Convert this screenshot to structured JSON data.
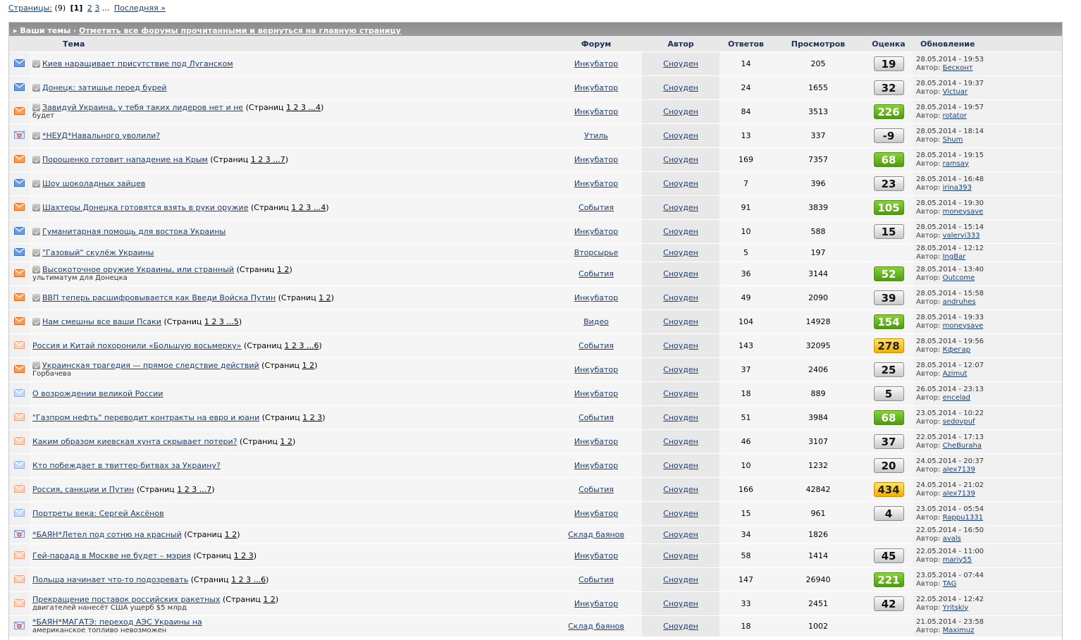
{
  "pager": {
    "label": "Страницы:",
    "count": "(9)",
    "current": "[1]",
    "pages": [
      "2",
      "3"
    ],
    "ellipsis": "...",
    "last": "Последняя »"
  },
  "bar": {
    "title": "Ваши темы",
    "sep": " · ",
    "link": "Отметить все форумы прочитанными и вернуться на главную страницу"
  },
  "headers": {
    "topic": "Тема",
    "forum": "Форум",
    "author": "Автор",
    "replies": "Ответов",
    "views": "Просмотров",
    "rating": "Оценка",
    "updated": "Обновление"
  },
  "strings": {
    "pages_prefix": "(Страниц ",
    "pages_suffix": ")",
    "author_prefix": "Автор:"
  },
  "colors": {
    "blue_env": "#4a7fc8",
    "orange_env": "#f07a22",
    "light_env": "#f3b89a",
    "green": "#67b21f",
    "yellow": "#f5c518"
  },
  "rows": [
    {
      "icon": "envelope-blue",
      "poll": true,
      "title": "Киев наращивает присутствие под Луганском",
      "pages": "",
      "sub": "",
      "forum": "Инкубатор",
      "author": "Сноуден",
      "replies": "14",
      "views": "205",
      "rating": "19",
      "rating_color": "gray",
      "date": "28.05.2014 - 19:53",
      "last_author": "Бесконт"
    },
    {
      "icon": "envelope-blue",
      "poll": true,
      "title": "Донецк: затишье перед бурей",
      "pages": "",
      "sub": "",
      "forum": "Инкубатор",
      "author": "Сноуден",
      "replies": "24",
      "views": "1655",
      "rating": "32",
      "rating_color": "gray",
      "date": "28.05.2014 - 19:37",
      "last_author": "Victuar"
    },
    {
      "icon": "envelope-orange",
      "poll": true,
      "title": "Завидуй Украина, у тебя таких лидеров нет и не",
      "pages": "1 2 3 ...4",
      "sub": "будет",
      "forum": "Инкубатор",
      "author": "Сноуден",
      "replies": "84",
      "views": "3513",
      "rating": "226",
      "rating_color": "green",
      "date": "28.05.2014 - 19:57",
      "last_author": "rotator"
    },
    {
      "icon": "locked",
      "poll": true,
      "title": "*НЕУД*Навального уволили?",
      "pages": "",
      "sub": "",
      "forum": "Утиль",
      "author": "Сноуден",
      "replies": "13",
      "views": "337",
      "rating": "-9",
      "rating_color": "gray",
      "date": "28.05.2014 - 18:14",
      "last_author": "Shum"
    },
    {
      "icon": "envelope-orange",
      "poll": true,
      "title": "Порошенко готовит нападение на Крым",
      "pages": "1 2 3 ...7",
      "sub": "",
      "forum": "Инкубатор",
      "author": "Сноуден",
      "replies": "169",
      "views": "7357",
      "rating": "68",
      "rating_color": "green",
      "date": "28.05.2014 - 19:15",
      "last_author": "ramsay"
    },
    {
      "icon": "envelope-blue",
      "poll": true,
      "title": "Шоу шоколадных зайцев",
      "pages": "",
      "sub": "",
      "forum": "Инкубатор",
      "author": "Сноуден",
      "replies": "7",
      "views": "396",
      "rating": "23",
      "rating_color": "gray",
      "date": "28.05.2014 - 16:48",
      "last_author": "irina393"
    },
    {
      "icon": "envelope-orange",
      "poll": true,
      "title": "Шахтеры Донецка готовятся взять в руки оружие",
      "pages": "1 2 3 ...4",
      "sub": "",
      "forum": "События",
      "author": "Сноуден",
      "replies": "91",
      "views": "3839",
      "rating": "105",
      "rating_color": "green",
      "date": "28.05.2014 - 19:30",
      "last_author": "moneysave"
    },
    {
      "icon": "envelope-blue",
      "poll": true,
      "title": "Гуманитарная помощь для востока Украины",
      "pages": "",
      "sub": "",
      "forum": "Инкубатор",
      "author": "Сноуден",
      "replies": "10",
      "views": "588",
      "rating": "15",
      "rating_color": "gray",
      "date": "28.05.2014 - 15:14",
      "last_author": "valeryi333"
    },
    {
      "icon": "envelope-blue",
      "poll": true,
      "title": "\"Газовый\" скулёж Украины",
      "pages": "",
      "sub": "",
      "forum": "Вторсырье",
      "author": "Сноуден",
      "replies": "5",
      "views": "197",
      "rating": "",
      "rating_color": "none",
      "date": "28.05.2014 - 12:12",
      "last_author": "IngBar"
    },
    {
      "icon": "envelope-orange",
      "poll": true,
      "title": "Высокоточное оружие Украины, или странный",
      "pages": "1 2",
      "sub": "ультиматум для Донецка",
      "forum": "События",
      "author": "Сноуден",
      "replies": "36",
      "views": "3144",
      "rating": "52",
      "rating_color": "green",
      "date": "28.05.2014 - 13:40",
      "last_author": "Outcome"
    },
    {
      "icon": "envelope-orange",
      "poll": true,
      "title": "ВВП теперь расшифровывается как Введи Войска Путин",
      "pages": "1 2",
      "sub": "",
      "forum": "Инкубатор",
      "author": "Сноуден",
      "replies": "49",
      "views": "2090",
      "rating": "39",
      "rating_color": "gray",
      "date": "28.05.2014 - 15:58",
      "last_author": "andruhes"
    },
    {
      "icon": "envelope-orange",
      "poll": true,
      "title": "Нам смешны все ваши Псаки",
      "pages": "1 2 3 ...5",
      "sub": "",
      "forum": "Видео",
      "author": "Сноуден",
      "replies": "104",
      "views": "14928",
      "rating": "154",
      "rating_color": "green",
      "date": "28.05.2014 - 19:33",
      "last_author": "moneysave"
    },
    {
      "icon": "envelope-light",
      "poll": false,
      "title": "Россия и Китай похоронили «Большую восьмерку»",
      "pages": "1 2 3 ...6",
      "sub": "",
      "forum": "События",
      "author": "Сноуден",
      "replies": "143",
      "views": "32095",
      "rating": "278",
      "rating_color": "yellow",
      "date": "28.05.2014 - 19:56",
      "last_author": "Кфегар"
    },
    {
      "icon": "envelope-orange",
      "poll": true,
      "title": "Украинская трагедия — прямое следствие действий",
      "pages": "1 2",
      "sub": "Горбачева",
      "forum": "Инкубатор",
      "author": "Сноуден",
      "replies": "37",
      "views": "2406",
      "rating": "25",
      "rating_color": "gray",
      "date": "28.05.2014 - 12:07",
      "last_author": "Azimut"
    },
    {
      "icon": "envelope-lightblue",
      "poll": false,
      "title": "О возрождении великой России",
      "pages": "",
      "sub": "",
      "forum": "Инкубатор",
      "author": "Сноуден",
      "replies": "18",
      "views": "889",
      "rating": "5",
      "rating_color": "gray",
      "date": "26.05.2014 - 23:13",
      "last_author": "encelad"
    },
    {
      "icon": "envelope-light",
      "poll": false,
      "title": "\"Газпром нефть\" переводит контракты на евро и юани",
      "pages": "1 2 3",
      "sub": "",
      "forum": "События",
      "author": "Сноуден",
      "replies": "51",
      "views": "3984",
      "rating": "68",
      "rating_color": "green",
      "date": "23.05.2014 - 10:22",
      "last_author": "sedovpuf"
    },
    {
      "icon": "envelope-light",
      "poll": false,
      "title": "Каким образом киевская хунта скрывает потери?",
      "pages": "1 2",
      "sub": "",
      "forum": "Инкубатор",
      "author": "Сноуден",
      "replies": "46",
      "views": "3107",
      "rating": "37",
      "rating_color": "gray",
      "date": "22.05.2014 - 17:13",
      "last_author": "CheBuraha"
    },
    {
      "icon": "envelope-lightblue",
      "poll": false,
      "title": "Кто побеждает в твиттер-битвах за Украину?",
      "pages": "",
      "sub": "",
      "forum": "Инкубатор",
      "author": "Сноуден",
      "replies": "10",
      "views": "1232",
      "rating": "20",
      "rating_color": "gray",
      "date": "24.05.2014 - 20:37",
      "last_author": "alex7139"
    },
    {
      "icon": "envelope-light",
      "poll": false,
      "title": "Россия, санкции и Путин",
      "pages": "1 2 3 ...7",
      "sub": "",
      "forum": "События",
      "author": "Сноуден",
      "replies": "166",
      "views": "42842",
      "rating": "434",
      "rating_color": "yellow",
      "date": "24.05.2014 - 21:02",
      "last_author": "alex7139"
    },
    {
      "icon": "envelope-lightblue",
      "poll": false,
      "title": "Портреты века: Сергей Аксёнов",
      "pages": "",
      "sub": "",
      "forum": "Инкубатор",
      "author": "Сноуден",
      "replies": "15",
      "views": "961",
      "rating": "4",
      "rating_color": "gray",
      "date": "23.05.2014 - 05:54",
      "last_author": "Rappu1331"
    },
    {
      "icon": "locked",
      "poll": false,
      "title": "*БАЯН*Летел под сотню на красный",
      "pages": "1 2",
      "sub": "",
      "forum": "Склад баянов",
      "author": "Сноуден",
      "replies": "34",
      "views": "1826",
      "rating": "",
      "rating_color": "none",
      "date": "22.05.2014 - 16:50",
      "last_author": "avals"
    },
    {
      "icon": "envelope-light",
      "poll": false,
      "title": "Гей-парада в Москве не будет – мэрия",
      "pages": "1 2 3",
      "sub": "",
      "forum": "Инкубатор",
      "author": "Сноуден",
      "replies": "58",
      "views": "1414",
      "rating": "45",
      "rating_color": "gray",
      "date": "22.05.2014 - 11:00",
      "last_author": "mariy55"
    },
    {
      "icon": "envelope-light",
      "poll": false,
      "title": "Польша начинает что-то подозревать",
      "pages": "1 2 3 ...6",
      "sub": "",
      "forum": "События",
      "author": "Сноуден",
      "replies": "147",
      "views": "26940",
      "rating": "221",
      "rating_color": "green",
      "date": "23.05.2014 - 07:44",
      "last_author": "TAG"
    },
    {
      "icon": "envelope-light",
      "poll": false,
      "title": "Прекращение поставок российских ракетных",
      "pages": "1 2",
      "sub": "двигателей нанесёт США ущерб $5 млрд",
      "forum": "Инкубатор",
      "author": "Сноуден",
      "replies": "33",
      "views": "2451",
      "rating": "42",
      "rating_color": "gray",
      "date": "22.05.2014 - 12:42",
      "last_author": "Yritskiy"
    },
    {
      "icon": "locked",
      "poll": false,
      "title": "*БАЯН*МАГАТЭ: переход АЭС Украины на",
      "pages": "",
      "sub": "американское топливо невозможен",
      "forum": "Склад баянов",
      "author": "Сноуден",
      "replies": "18",
      "views": "1002",
      "rating": "",
      "rating_color": "none",
      "date": "21.05.2014 - 23:58",
      "last_author": "Maximuz"
    }
  ]
}
